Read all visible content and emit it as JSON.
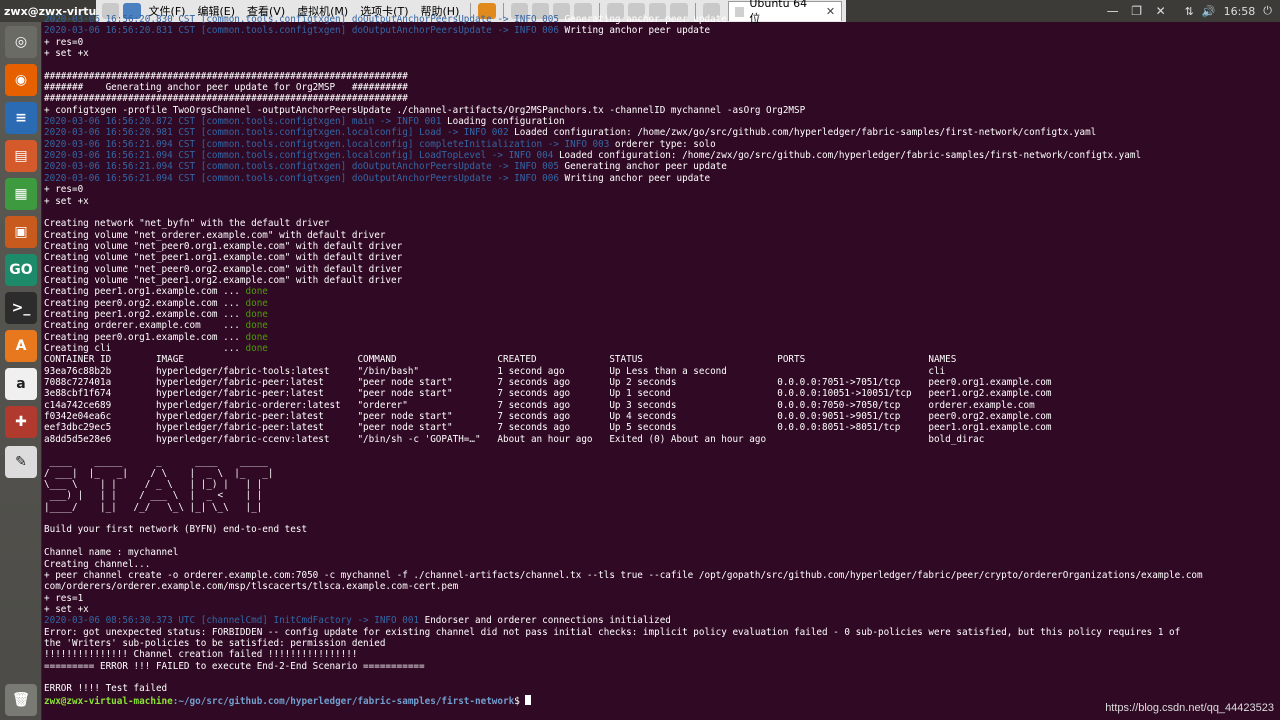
{
  "topbar": {
    "title": "zwx@zwx-virtual-m",
    "menus": [
      "文件(F)",
      "编辑(E)",
      "查看(V)",
      "虚拟机(M)",
      "选项卡(T)",
      "帮助(H)"
    ],
    "tab_label": "Ubuntu 64 位",
    "tab_close": "✕",
    "time": "16:58",
    "win_minimize": "—",
    "win_restore": "❐",
    "win_close": "✕",
    "tray_net": "⇅",
    "tray_vol": "🔊",
    "tray_power": "⏻"
  },
  "launcher": {
    "items": [
      {
        "name": "dash-icon",
        "glyph": "◎",
        "color": "#6b6b66"
      },
      {
        "name": "firefox-icon",
        "glyph": "◉",
        "color": "#e66000"
      },
      {
        "name": "libreoffice-writer-icon",
        "glyph": "≡",
        "color": "#2a6bb3"
      },
      {
        "name": "files-icon",
        "glyph": "▤",
        "color": "#d45a2b"
      },
      {
        "name": "libreoffice-calc-icon",
        "glyph": "▦",
        "color": "#3e9a3e"
      },
      {
        "name": "libreoffice-impress-icon",
        "glyph": "▣",
        "color": "#c95a1e"
      },
      {
        "name": "goland-icon",
        "glyph": "GO",
        "color": "#1d8a6a"
      },
      {
        "name": "terminal-icon",
        "glyph": ">_",
        "color": "#2c2c2c"
      },
      {
        "name": "software-center-icon",
        "glyph": "A",
        "color": "#e8781e"
      },
      {
        "name": "amazon-icon",
        "glyph": "a",
        "color": "#f0f0f0"
      },
      {
        "name": "system-settings-icon",
        "glyph": "✚",
        "color": "#b03a2e"
      },
      {
        "name": "text-editor-icon",
        "glyph": "✎",
        "color": "#dcdcdc"
      },
      {
        "name": "trash-icon",
        "glyph": "🗑",
        "color": "#7a7a75"
      }
    ]
  },
  "terminal": {
    "lines": [
      [
        {
          "t": "2020-03-06 16:56:20.830 CST [common.tools.configtxgen] doOutputAnchorPeersUpdate -> INFO 005",
          "c": "dim"
        },
        {
          "t": " Generating anchor peer update"
        }
      ],
      [
        {
          "t": "2020-03-06 16:56:20.831 CST [common.tools.configtxgen] doOutputAnchorPeersUpdate -> INFO 006",
          "c": "dim"
        },
        {
          "t": " Writing anchor peer update"
        }
      ],
      [
        {
          "t": "+ res=0"
        }
      ],
      [
        {
          "t": "+ set +x"
        }
      ],
      [
        {
          "t": ""
        }
      ],
      [
        {
          "t": "#################################################################"
        }
      ],
      [
        {
          "t": "#######    Generating anchor peer update for Org2MSP   ##########"
        }
      ],
      [
        {
          "t": "#################################################################"
        }
      ],
      [
        {
          "t": "+ configtxgen -profile TwoOrgsChannel -outputAnchorPeersUpdate ./channel-artifacts/Org2MSPanchors.tx -channelID mychannel -asOrg Org2MSP"
        }
      ],
      [
        {
          "t": "2020-03-06 16:56:20.872 CST [common.tools.configtxgen] main -> INFO 001",
          "c": "dim"
        },
        {
          "t": " Loading configuration"
        }
      ],
      [
        {
          "t": "2020-03-06 16:56:20.981 CST [common.tools.configtxgen.localconfig] Load -> INFO 002",
          "c": "dim"
        },
        {
          "t": " Loaded configuration: /home/zwx/go/src/github.com/hyperledger/fabric-samples/first-network/configtx.yaml"
        }
      ],
      [
        {
          "t": "2020-03-06 16:56:21.094 CST [common.tools.configtxgen.localconfig] completeInitialization -> INFO 003",
          "c": "dim"
        },
        {
          "t": " orderer type: solo"
        }
      ],
      [
        {
          "t": "2020-03-06 16:56:21.094 CST [common.tools.configtxgen.localconfig] LoadTopLevel -> INFO 004",
          "c": "dim"
        },
        {
          "t": " Loaded configuration: /home/zwx/go/src/github.com/hyperledger/fabric-samples/first-network/configtx.yaml"
        }
      ],
      [
        {
          "t": "2020-03-06 16:56:21.094 CST [common.tools.configtxgen] doOutputAnchorPeersUpdate -> INFO 005",
          "c": "dim"
        },
        {
          "t": " Generating anchor peer update"
        }
      ],
      [
        {
          "t": "2020-03-06 16:56:21.094 CST [common.tools.configtxgen] doOutputAnchorPeersUpdate -> INFO 006",
          "c": "dim"
        },
        {
          "t": " Writing anchor peer update"
        }
      ],
      [
        {
          "t": "+ res=0"
        }
      ],
      [
        {
          "t": "+ set +x"
        }
      ],
      [
        {
          "t": ""
        }
      ],
      [
        {
          "t": "Creating network \"net_byfn\" with the default driver"
        }
      ],
      [
        {
          "t": "Creating volume \"net_orderer.example.com\" with default driver"
        }
      ],
      [
        {
          "t": "Creating volume \"net_peer0.org1.example.com\" with default driver"
        }
      ],
      [
        {
          "t": "Creating volume \"net_peer1.org1.example.com\" with default driver"
        }
      ],
      [
        {
          "t": "Creating volume \"net_peer0.org2.example.com\" with default driver"
        }
      ],
      [
        {
          "t": "Creating volume \"net_peer1.org2.example.com\" with default driver"
        }
      ],
      [
        {
          "t": "Creating peer1.org1.example.com ... "
        },
        {
          "t": "done",
          "c": "ok"
        }
      ],
      [
        {
          "t": "Creating peer0.org2.example.com ... "
        },
        {
          "t": "done",
          "c": "ok"
        }
      ],
      [
        {
          "t": "Creating peer1.org2.example.com ... "
        },
        {
          "t": "done",
          "c": "ok"
        }
      ],
      [
        {
          "t": "Creating orderer.example.com    ... "
        },
        {
          "t": "done",
          "c": "ok"
        }
      ],
      [
        {
          "t": "Creating peer0.org1.example.com ... "
        },
        {
          "t": "done",
          "c": "ok"
        }
      ],
      [
        {
          "t": "Creating cli                    ... "
        },
        {
          "t": "done",
          "c": "ok"
        }
      ],
      [
        {
          "t": "CONTAINER ID        IMAGE                               COMMAND                  CREATED             STATUS                        PORTS                      NAMES"
        }
      ],
      [
        {
          "t": "93ea76c88b2b        hyperledger/fabric-tools:latest     \"/bin/bash\"              1 second ago        Up Less than a second                                    cli"
        }
      ],
      [
        {
          "t": "7088c727401a        hyperledger/fabric-peer:latest      \"peer node start\"        7 seconds ago       Up 2 seconds                  0.0.0.0:7051->7051/tcp     peer0.org1.example.com"
        }
      ],
      [
        {
          "t": "3e88cbf1f674        hyperledger/fabric-peer:latest      \"peer node start\"        7 seconds ago       Up 1 second                   0.0.0.0:10051->10051/tcp   peer1.org2.example.com"
        }
      ],
      [
        {
          "t": "c14a742ce689        hyperledger/fabric-orderer:latest   \"orderer\"                7 seconds ago       Up 3 seconds                  0.0.0.0:7050->7050/tcp     orderer.example.com"
        }
      ],
      [
        {
          "t": "f0342e04ea6c        hyperledger/fabric-peer:latest      \"peer node start\"        7 seconds ago       Up 4 seconds                  0.0.0.0:9051->9051/tcp     peer0.org2.example.com"
        }
      ],
      [
        {
          "t": "eef3dbc29ec5        hyperledger/fabric-peer:latest      \"peer node start\"        7 seconds ago       Up 5 seconds                  0.0.0.0:8051->8051/tcp     peer1.org1.example.com"
        }
      ],
      [
        {
          "t": "a8dd5d5e28e6        hyperledger/fabric-ccenv:latest     \"/bin/sh -c 'GOPATH=…\"   About an hour ago   Exited (0) About an hour ago                             bold_dirac"
        }
      ],
      [
        {
          "t": ""
        }
      ],
      [
        {
          "t": " ____    _____      _      ____    _____ "
        }
      ],
      [
        {
          "t": "/ ___|  |_   _|    / \\    |  _ \\  |_   _|"
        }
      ],
      [
        {
          "t": "\\___ \\    | |     / _ \\   | |_) |   | |  "
        }
      ],
      [
        {
          "t": " ___) |   | |    / ___ \\  |  _ <    | |  "
        }
      ],
      [
        {
          "t": "|____/    |_|   /_/   \\_\\ |_| \\_\\   |_|  "
        }
      ],
      [
        {
          "t": ""
        }
      ],
      [
        {
          "t": "Build your first network (BYFN) end-to-end test"
        }
      ],
      [
        {
          "t": ""
        }
      ],
      [
        {
          "t": "Channel name : mychannel"
        }
      ],
      [
        {
          "t": "Creating channel..."
        }
      ],
      [
        {
          "t": "+ peer channel create -o orderer.example.com:7050 -c mychannel -f ./channel-artifacts/channel.tx --tls true --cafile /opt/gopath/src/github.com/hyperledger/fabric/peer/crypto/ordererOrganizations/example.com"
        }
      ],
      [
        {
          "t": "com/orderers/orderer.example.com/msp/tlscacerts/tlsca.example.com-cert.pem"
        }
      ],
      [
        {
          "t": "+ res=1"
        }
      ],
      [
        {
          "t": "+ set +x"
        }
      ],
      [
        {
          "t": "2020-03-06 08:56:30.373 UTC [channelCmd] InitCmdFactory -> INFO 001",
          "c": "dim"
        },
        {
          "t": " Endorser and orderer connections initialized"
        }
      ],
      [
        {
          "t": "Error: got unexpected status: FORBIDDEN -- config update for existing channel did not pass initial checks: implicit policy evaluation failed - 0 sub-policies were satisfied, but this policy requires 1 of"
        }
      ],
      [
        {
          "t": "the 'Writers' sub-policies to be satisfied: permission denied"
        }
      ],
      [
        {
          "t": "!!!!!!!!!!!!!!! Channel creation failed !!!!!!!!!!!!!!!!"
        }
      ],
      [
        {
          "t": "========= ERROR !!! FAILED to execute End-2-End Scenario ==========="
        }
      ],
      [
        {
          "t": ""
        }
      ],
      [
        {
          "t": "ERROR !!!! Test failed"
        }
      ]
    ],
    "prompt_user": "zwx@zwx-virtual-machine",
    "prompt_path": ":~/go/src/github.com/hyperledger/fabric-samples/first-network",
    "prompt_symbol": "$ "
  },
  "watermark": "https://blog.csdn.net/qq_44423523"
}
